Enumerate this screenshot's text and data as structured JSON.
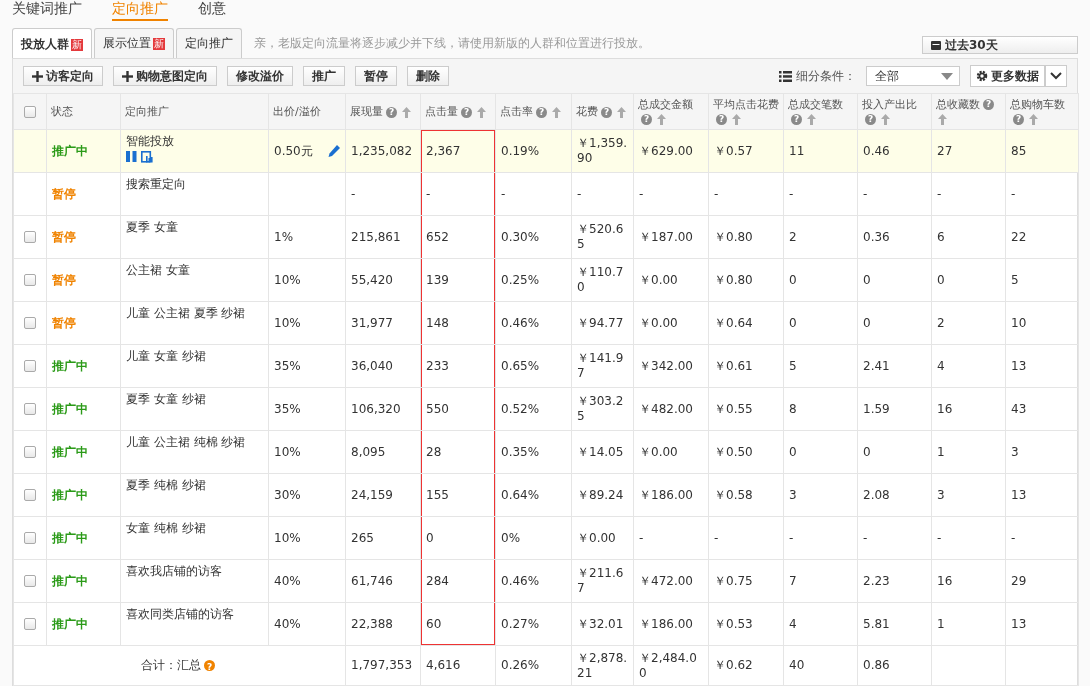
{
  "top_tabs": [
    {
      "label": "关键词推广",
      "selected": false
    },
    {
      "label": "定向推广",
      "selected": true
    },
    {
      "label": "创意",
      "selected": false
    }
  ],
  "sub_tabs": [
    {
      "label": "投放人群",
      "badge": "新",
      "selected": true
    },
    {
      "label": "展示位置",
      "badge": "新",
      "selected": false
    },
    {
      "label": "定向推广",
      "selected": false
    }
  ],
  "notice": "亲，老版定向流量将逐步减少并下线，请使用新版的人群和位置进行投放。",
  "date_button": "过去30天",
  "toolbar": [
    {
      "label": "访客定向",
      "kind": "add"
    },
    {
      "label": "购物意图定向",
      "kind": "add"
    },
    {
      "label": "修改溢价",
      "kind": "plain"
    },
    {
      "label": "推广",
      "kind": "plain"
    },
    {
      "label": "暂停",
      "kind": "plain"
    },
    {
      "label": "删除",
      "kind": "plain"
    }
  ],
  "filter": {
    "label": "细分条件：",
    "value": "全部"
  },
  "more_button": "更多数据",
  "table": {
    "select_all_checked": false,
    "columns": [
      {
        "label": "状态",
        "sortable": false
      },
      {
        "label": "定向推广",
        "sortable": false
      },
      {
        "label": "出价/溢价",
        "sortable": false
      },
      {
        "label": "展现量",
        "help": "?",
        "sortable": true
      },
      {
        "label": "点击量",
        "help": "?",
        "sortable": true,
        "outlined": true
      },
      {
        "label": "点击率",
        "help": "?",
        "sortable": true
      },
      {
        "label": "花费",
        "help": "?",
        "sortable": true
      },
      {
        "label": "总成交金额",
        "help": "?",
        "sortable": true
      },
      {
        "label": "平均点击花费",
        "help": "?",
        "sortable": true
      },
      {
        "label": "总成交笔数",
        "help": "?",
        "sortable": true
      },
      {
        "label": "投入产出比",
        "help": "?",
        "sortable": true
      },
      {
        "label": "总收藏数",
        "help": "?",
        "sortable": true
      },
      {
        "label": "总购物车数",
        "help": "?",
        "sortable": true
      }
    ],
    "rows": [
      {
        "kind": "smart",
        "highlighted": true,
        "status": "推广中",
        "paused": false,
        "name": "智能投放",
        "price": "0.50元",
        "metrics": [
          "1,235,082",
          "2,367",
          "0.19%",
          "￥1,359.90",
          "￥629.00",
          "￥0.57",
          "11",
          "0.46",
          "27",
          "85"
        ]
      },
      {
        "kind": "normal",
        "highlighted": false,
        "status": "暂停",
        "paused": true,
        "name": "搜索重定向",
        "metrics": [
          "-",
          "-",
          "-",
          "-",
          "-",
          "-",
          "-",
          "-",
          "-",
          "-"
        ]
      },
      {
        "kind": "normal",
        "highlighted": false,
        "checked": false,
        "status": "暂停",
        "paused": true,
        "name": "夏季 女童",
        "price": "1%",
        "metrics": [
          "215,861",
          "652",
          "0.30%",
          "￥520.65",
          "￥187.00",
          "￥0.80",
          "2",
          "0.36",
          "6",
          "22"
        ]
      },
      {
        "kind": "normal",
        "highlighted": false,
        "checked": false,
        "status": "暂停",
        "paused": true,
        "name": "公主裙 女童",
        "price": "10%",
        "metrics": [
          "55,420",
          "139",
          "0.25%",
          "￥110.70",
          "￥0.00",
          "￥0.80",
          "0",
          "0",
          "0",
          "5"
        ]
      },
      {
        "kind": "normal",
        "highlighted": false,
        "checked": false,
        "status": "暂停",
        "paused": true,
        "name": "儿童 公主裙 夏季 纱裙",
        "price": "10%",
        "metrics": [
          "31,977",
          "148",
          "0.46%",
          "￥94.77",
          "￥0.00",
          "￥0.64",
          "0",
          "0",
          "2",
          "10"
        ]
      },
      {
        "kind": "normal",
        "highlighted": false,
        "checked": false,
        "status": "推广中",
        "paused": false,
        "name": "儿童 女童 纱裙",
        "price": "35%",
        "metrics": [
          "36,040",
          "233",
          "0.65%",
          "￥141.97",
          "￥342.00",
          "￥0.61",
          "5",
          "2.41",
          "4",
          "13"
        ]
      },
      {
        "kind": "normal",
        "highlighted": false,
        "checked": false,
        "status": "推广中",
        "paused": false,
        "name": "夏季 女童 纱裙",
        "price": "35%",
        "metrics": [
          "106,320",
          "550",
          "0.52%",
          "￥303.25",
          "￥482.00",
          "￥0.55",
          "8",
          "1.59",
          "16",
          "43"
        ]
      },
      {
        "kind": "normal",
        "highlighted": false,
        "checked": false,
        "status": "推广中",
        "paused": false,
        "name": "儿童 公主裙 纯棉 纱裙",
        "price": "10%",
        "metrics": [
          "8,095",
          "28",
          "0.35%",
          "￥14.05",
          "￥0.00",
          "￥0.50",
          "0",
          "0",
          "1",
          "3"
        ]
      },
      {
        "kind": "normal",
        "highlighted": false,
        "checked": false,
        "status": "推广中",
        "paused": false,
        "name": "夏季 纯棉 纱裙",
        "price": "30%",
        "metrics": [
          "24,159",
          "155",
          "0.64%",
          "￥89.24",
          "￥186.00",
          "￥0.58",
          "3",
          "2.08",
          "3",
          "13"
        ]
      },
      {
        "kind": "normal",
        "highlighted": false,
        "checked": false,
        "status": "推广中",
        "paused": false,
        "name": "女童 纯棉 纱裙",
        "price": "10%",
        "metrics": [
          "265",
          "0",
          "0%",
          "￥0.00",
          "-",
          "-",
          "-",
          "-",
          "-",
          "-"
        ]
      },
      {
        "kind": "normal",
        "highlighted": false,
        "checked": false,
        "status": "推广中",
        "paused": false,
        "name": "喜欢我店铺的访客",
        "price": "40%",
        "metrics": [
          "61,746",
          "284",
          "0.46%",
          "￥211.67",
          "￥472.00",
          "￥0.75",
          "7",
          "2.23",
          "16",
          "29"
        ]
      },
      {
        "kind": "normal",
        "highlighted": false,
        "checked": false,
        "status": "推广中",
        "paused": false,
        "name": "喜欢同类店铺的访客",
        "price": "40%",
        "metrics": [
          "22,388",
          "60",
          "0.27%",
          "￥32.01",
          "￥186.00",
          "￥0.53",
          "4",
          "5.81",
          "1",
          "13"
        ]
      }
    ],
    "total": {
      "label": "合计：汇总",
      "help": "?",
      "metrics": [
        "1,797,353",
        "4,616",
        "0.26%",
        "￥2,878.21",
        "￥2,484.00",
        "￥0.62",
        "40",
        "0.86"
      ]
    }
  }
}
